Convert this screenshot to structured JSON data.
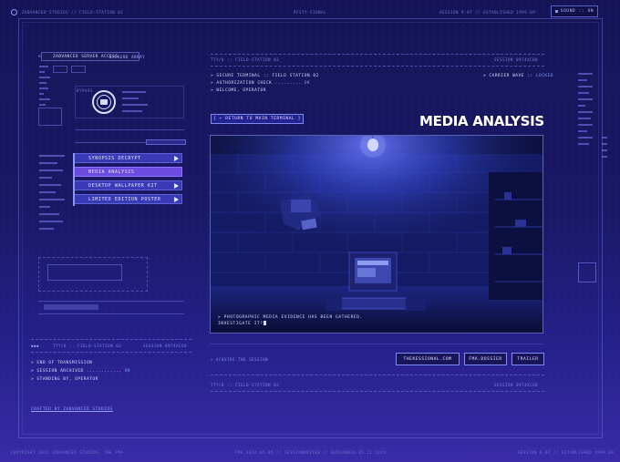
{
  "top_bar": {
    "left_text": "ZABVANCED STUDIOS // FIELD-STATION 02",
    "center_text": "RFSTY-SIGNAL",
    "right_text": "SESSION R-07 // ESTABLISHED 1999.09",
    "sound_label": "SOUND :: ON"
  },
  "left_panel": {
    "header": "ZABVANCED SERVER ACCESS",
    "header_tag": "BACKEND ARRAY",
    "bypass": "BYPASS",
    "nav_prefix": "NAV",
    "nav_items": [
      {
        "label": "SYNOPSIS DECRYPT",
        "active": false
      },
      {
        "label": "MEDIA ANALYSIS",
        "active": true
      },
      {
        "label": "DESKTOP WALLPAPER KIT",
        "active": false
      },
      {
        "label": "LIMITED EDITION POSTER",
        "active": false
      }
    ]
  },
  "main": {
    "head_left": "TTY/0 :: FIELD-STATION 02",
    "head_right": "SESSION 0974XC60",
    "terminal": [
      {
        "text": "> SECURE TERMINAL :: FIELD STATION 02",
        "status": ""
      },
      {
        "text": "> AUTHORIZATION CHECK .........",
        "status": "OK"
      },
      {
        "text": "> WELCOME, OPERATOR",
        "status": ""
      }
    ],
    "carrier": "> CARRIER WAVE ::",
    "carrier_status": "LOCKED",
    "return_button": "[ ← RETURN TO MAIN TERMINAL ]",
    "title": "MEDIA ANALYSIS",
    "caption_line1": "> PHOTOGRAPHIC MEDIA EVIDENCE HAS BEEN GATHERED.",
    "caption_line2": "INVESTIGATE IT?",
    "acquire": "> ACQUIRE THE SESSION",
    "links": [
      "THEKESSIONAL.COM",
      "FMA.DOSSIER",
      "TRAILER"
    ],
    "footer_left": "TTY/0 :: FIELD-STATION 02",
    "footer_right": "SESSION 0974XC60"
  },
  "bottom_left": {
    "head_left": "TTY/0 :: FIELD-STATION 02",
    "head_right": "SESSION 0974XC60",
    "lines": [
      {
        "text": "> END OF TRANSMISSION",
        "status": ""
      },
      {
        "text": "> SESSION ARCHIVED ............",
        "status": "OK"
      },
      {
        "text": "> STANDING BY, OPERATOR",
        "status": ""
      }
    ],
    "crafted": "CRAFTED BY ZABVANCED STUDIOS"
  },
  "footer": {
    "left": "COPYRIGHT 2024 ZABVANCED STUDIOS. THE FMA",
    "center": "FMA.1024.05.05 // SESSIONREVIEW // BUILD0024.05.21.2024",
    "right": "SESSION R-07 // ESTABLISHED 1999.09"
  },
  "colors": {
    "accent": "#6b4be0",
    "nav": "#3a3ab7",
    "bg": "#1a1866",
    "ok": "#7b9bff"
  }
}
